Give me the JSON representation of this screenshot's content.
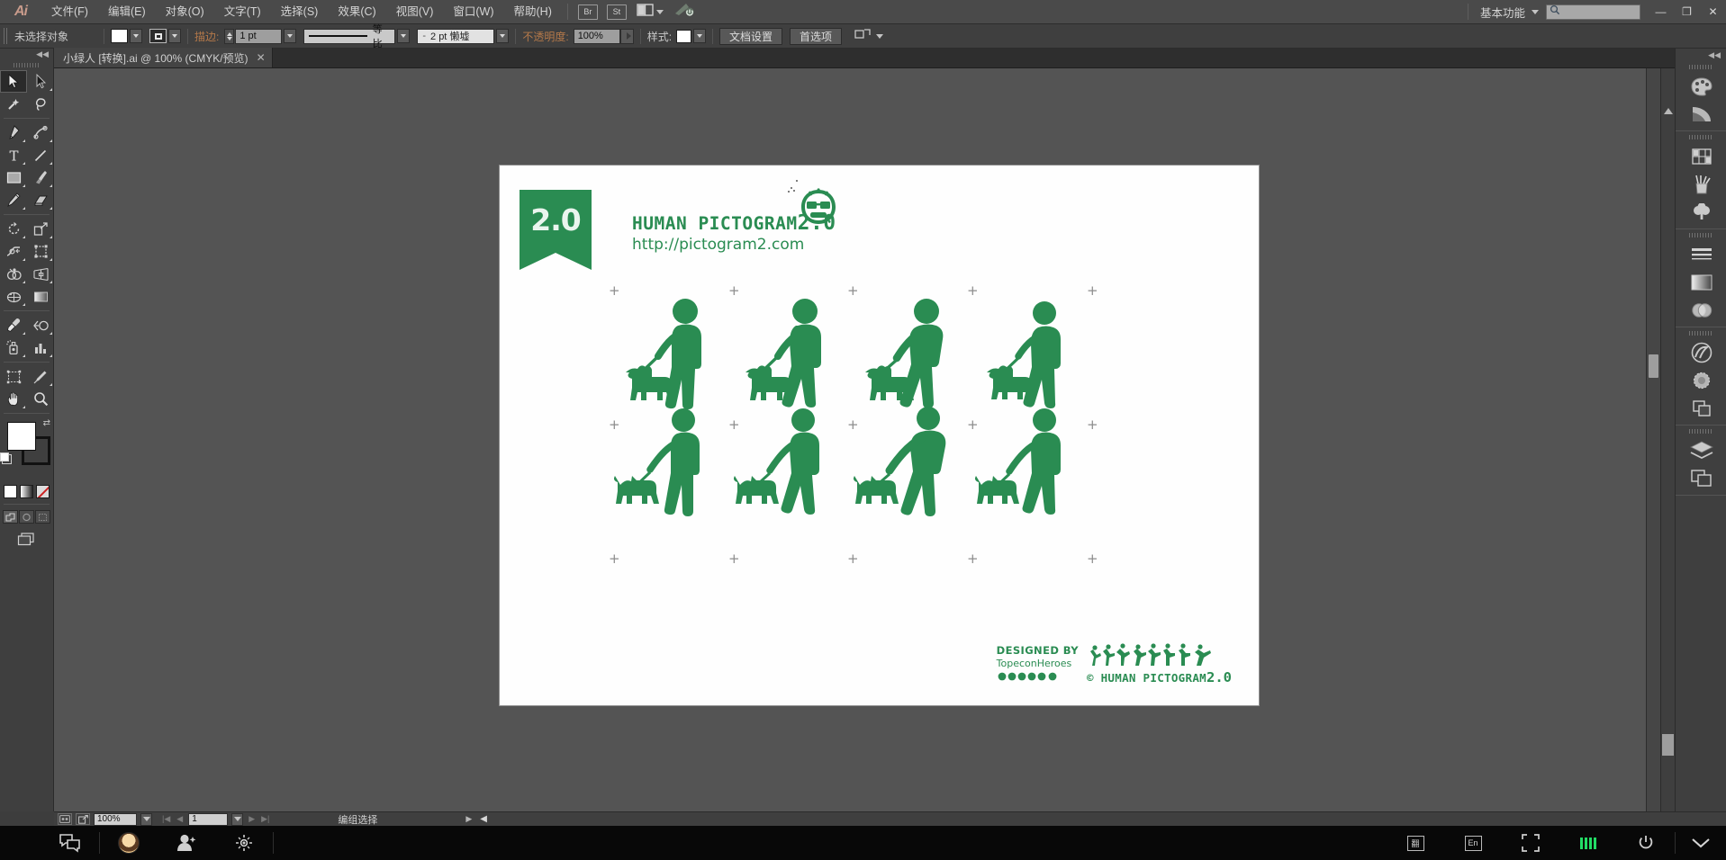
{
  "app": {
    "name": "Adobe Illustrator",
    "logo_text": "Ai"
  },
  "menubar": {
    "items": [
      {
        "label": "文件(F)",
        "name": "menu-file"
      },
      {
        "label": "编辑(E)",
        "name": "menu-edit"
      },
      {
        "label": "对象(O)",
        "name": "menu-object"
      },
      {
        "label": "文字(T)",
        "name": "menu-type"
      },
      {
        "label": "选择(S)",
        "name": "menu-select"
      },
      {
        "label": "效果(C)",
        "name": "menu-effect"
      },
      {
        "label": "视图(V)",
        "name": "menu-view"
      },
      {
        "label": "窗口(W)",
        "name": "menu-window"
      },
      {
        "label": "帮助(H)",
        "name": "menu-help"
      }
    ],
    "bridge_label": "Br",
    "stock_label": "St",
    "workspace_label": "基本功能",
    "search_placeholder": "",
    "minimize": "—",
    "restore": "❐",
    "close": "✕"
  },
  "controlbar": {
    "selection_status": "未选择对象",
    "fill_color": "#ffffff",
    "stroke_label": "描边:",
    "stroke_weight": "1 pt",
    "stroke_profile": "等比",
    "brush_def": "2 pt 懒墟",
    "opacity_label": "不透明度:",
    "opacity_value": "100%",
    "style_label": "样式:",
    "doc_setup_button": "文档设置",
    "preferences_button": "首选项"
  },
  "tabs": [
    {
      "title": "小绿人 [转换].ai @ 100% (CMYK/预览)",
      "close": "✕"
    }
  ],
  "toolbar": {
    "collapse": "◀◀",
    "tools": [
      {
        "name": "selection-tool",
        "label": "选择工具",
        "active": true
      },
      {
        "name": "direct-selection-tool",
        "label": "直接选择工具",
        "active": false
      },
      {
        "name": "magic-wand-tool",
        "label": "魔棒工具",
        "active": false
      },
      {
        "name": "lasso-tool",
        "label": "套索工具",
        "active": false
      },
      {
        "name": "pen-tool",
        "label": "钢笔工具",
        "active": false
      },
      {
        "name": "curvature-tool",
        "label": "曲率工具",
        "active": false
      },
      {
        "name": "type-tool",
        "label": "文字工具",
        "active": false
      },
      {
        "name": "line-segment-tool",
        "label": "直线段工具",
        "active": false
      },
      {
        "name": "rectangle-tool",
        "label": "矩形工具",
        "active": false
      },
      {
        "name": "paintbrush-tool",
        "label": "画笔工具",
        "active": false
      },
      {
        "name": "pencil-tool",
        "label": "铅笔工具",
        "active": false
      },
      {
        "name": "eraser-tool",
        "label": "橡皮擦工具",
        "active": false
      },
      {
        "name": "rotate-tool",
        "label": "旋转工具",
        "active": false
      },
      {
        "name": "scale-tool",
        "label": "比例缩放工具",
        "active": false
      },
      {
        "name": "width-tool",
        "label": "宽度工具",
        "active": false
      },
      {
        "name": "free-transform-tool",
        "label": "自由变换工具",
        "active": false
      },
      {
        "name": "shape-builder-tool",
        "label": "形状生成器工具",
        "active": false
      },
      {
        "name": "perspective-grid-tool",
        "label": "透视网格工具",
        "active": false
      },
      {
        "name": "mesh-tool",
        "label": "网格工具",
        "active": false
      },
      {
        "name": "gradient-tool",
        "label": "渐变工具",
        "active": false
      },
      {
        "name": "eyedropper-tool",
        "label": "吸管工具",
        "active": false
      },
      {
        "name": "blend-tool",
        "label": "混合工具",
        "active": false
      },
      {
        "name": "symbol-sprayer-tool",
        "label": "符号喷枪工具",
        "active": false
      },
      {
        "name": "column-graph-tool",
        "label": "柱形图工具",
        "active": false
      },
      {
        "name": "artboard-tool",
        "label": "画板工具",
        "active": false
      },
      {
        "name": "slice-tool",
        "label": "切片工具",
        "active": false
      },
      {
        "name": "hand-tool",
        "label": "抓手工具",
        "active": false
      },
      {
        "name": "zoom-tool",
        "label": "缩放工具",
        "active": false
      }
    ],
    "fill_swatch": "#ffffff",
    "stroke_swatch": "#000000",
    "color_modes": [
      "颜色",
      "渐变",
      "无"
    ],
    "draw_modes": [
      "正常绘图",
      "背面绘图",
      "内部绘图"
    ],
    "screen_mode": "更改屏幕模式"
  },
  "artwork": {
    "banner_version": "2.0",
    "title_main": "HUMAN PICTOGRAM",
    "title_version": "2.0",
    "url": "http://pictogram2.com",
    "green": "#2a8c52",
    "designed_by_label": "DESIGNED BY",
    "designer": "TopeconHeroes",
    "copyright": "© HUMAN PICTOGRAM",
    "copyright_version": "2.0",
    "crop_mark": "+",
    "figures": [
      {
        "name": "dog-walk-figure-1",
        "row": 0,
        "col": 0
      },
      {
        "name": "dog-walk-figure-2",
        "row": 0,
        "col": 1
      },
      {
        "name": "dog-walk-figure-3",
        "row": 0,
        "col": 2
      },
      {
        "name": "dog-walk-figure-4",
        "row": 0,
        "col": 3
      },
      {
        "name": "dog-walk-figure-5",
        "row": 1,
        "col": 0
      },
      {
        "name": "dog-walk-figure-6",
        "row": 1,
        "col": 1
      },
      {
        "name": "dog-walk-figure-7",
        "row": 1,
        "col": 2
      },
      {
        "name": "dog-walk-figure-8",
        "row": 1,
        "col": 3
      }
    ]
  },
  "dock": {
    "collapse": "◀◀",
    "panels": [
      {
        "name": "panel-color",
        "label": "颜色"
      },
      {
        "name": "panel-color-guide",
        "label": "颜色参考"
      },
      {
        "name": "panel-swatches",
        "label": "色板"
      },
      {
        "name": "panel-brushes",
        "label": "画笔"
      },
      {
        "name": "panel-symbols",
        "label": "符号"
      },
      {
        "name": "panel-stroke",
        "label": "描边"
      },
      {
        "name": "panel-gradient",
        "label": "渐变"
      },
      {
        "name": "panel-transparency",
        "label": "透明度"
      },
      {
        "name": "panel-cc-libraries",
        "label": "CC Libraries"
      },
      {
        "name": "panel-align",
        "label": "对齐"
      },
      {
        "name": "panel-pathfinder",
        "label": "路径查找器"
      },
      {
        "name": "panel-layers",
        "label": "图层"
      },
      {
        "name": "panel-artboards",
        "label": "画板"
      }
    ]
  },
  "statusbar": {
    "zoom": "100%",
    "page": "1",
    "status_text": "编组选择",
    "prev_arrow": "◀",
    "next_arrow": "▶"
  },
  "taskbar": {
    "items": [
      {
        "name": "taskbar-chat-icon",
        "glyph": "chat"
      },
      {
        "name": "taskbar-avatar",
        "glyph": "avatar"
      },
      {
        "name": "taskbar-contacts-icon",
        "glyph": "contacts"
      },
      {
        "name": "taskbar-settings-icon",
        "glyph": "settings"
      }
    ],
    "tray": [
      {
        "name": "tray-translate-icon",
        "label": "翻"
      },
      {
        "name": "tray-ime-icon",
        "label": "En"
      },
      {
        "name": "tray-capture-icon",
        "label": "capture"
      },
      {
        "name": "tray-signal-icon",
        "label": "signal"
      },
      {
        "name": "tray-power-icon",
        "label": "⏻"
      },
      {
        "name": "tray-expand-icon",
        "label": "⌄"
      }
    ]
  }
}
